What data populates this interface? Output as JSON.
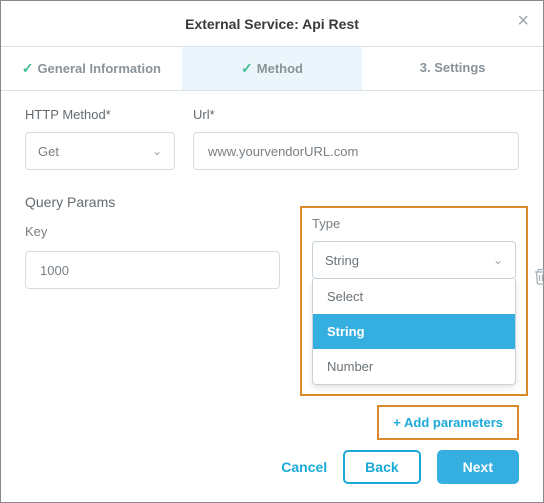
{
  "header": {
    "title": "External Service: Api Rest"
  },
  "tabs": {
    "general": {
      "label": "General Information"
    },
    "method": {
      "label": "Method"
    },
    "settings": {
      "label": "3. Settings"
    }
  },
  "fields": {
    "httpMethod": {
      "label": "HTTP Method*",
      "value": "Get"
    },
    "url": {
      "label": "Url*",
      "value": "www.yourvendorURL.com"
    }
  },
  "queryParams": {
    "sectionLabel": "Query Params",
    "keyLabel": "Key",
    "typeLabel": "Type",
    "keyValue": "1000",
    "typeValue": "String",
    "options": {
      "select": "Select",
      "string": "String",
      "number": "Number"
    },
    "addButton": "+ Add parameters"
  },
  "footer": {
    "cancel": "Cancel",
    "back": "Back",
    "next": "Next"
  }
}
